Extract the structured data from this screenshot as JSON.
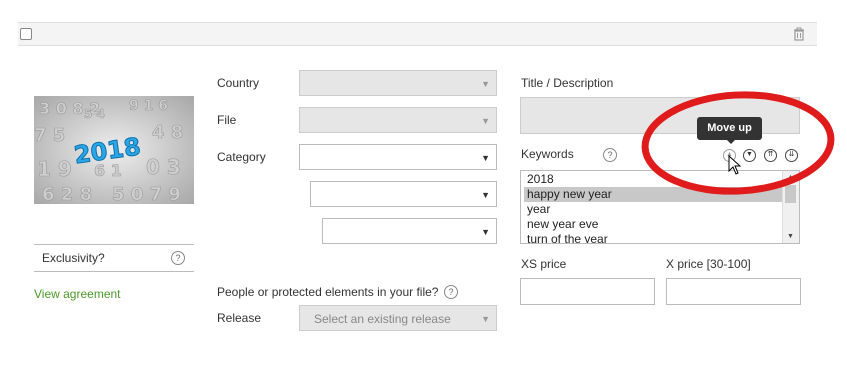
{
  "form": {
    "country_label": "Country",
    "file_label": "File",
    "category_label": "Category",
    "title_label": "Title / Description",
    "keywords_label": "Keywords",
    "exclusivity_label": "Exclusivity?",
    "help_glyph": "?",
    "view_agreement": "View agreement",
    "people_label": "People or protected elements in your file?",
    "release_label": "Release",
    "release_placeholder": "Select an existing release",
    "xs_price_label": "XS price",
    "x_price_label": "X price [30-100]"
  },
  "thumbnail": {
    "text": "2018",
    "accent": "#2aa7e8"
  },
  "keywords": [
    "2018",
    "happy new year",
    "year",
    "new year eve",
    "turn of the year"
  ],
  "selected_keyword_index": 1,
  "tooltip": "Move up",
  "colors": {
    "highlight_ring": "#e01b1b",
    "link": "#4a9a2a"
  },
  "icons": [
    "checkbox-icon",
    "trash-icon",
    "help-icon",
    "move-up-icon",
    "move-down-icon",
    "move-top-icon",
    "move-bottom-icon",
    "cursor-icon"
  ]
}
